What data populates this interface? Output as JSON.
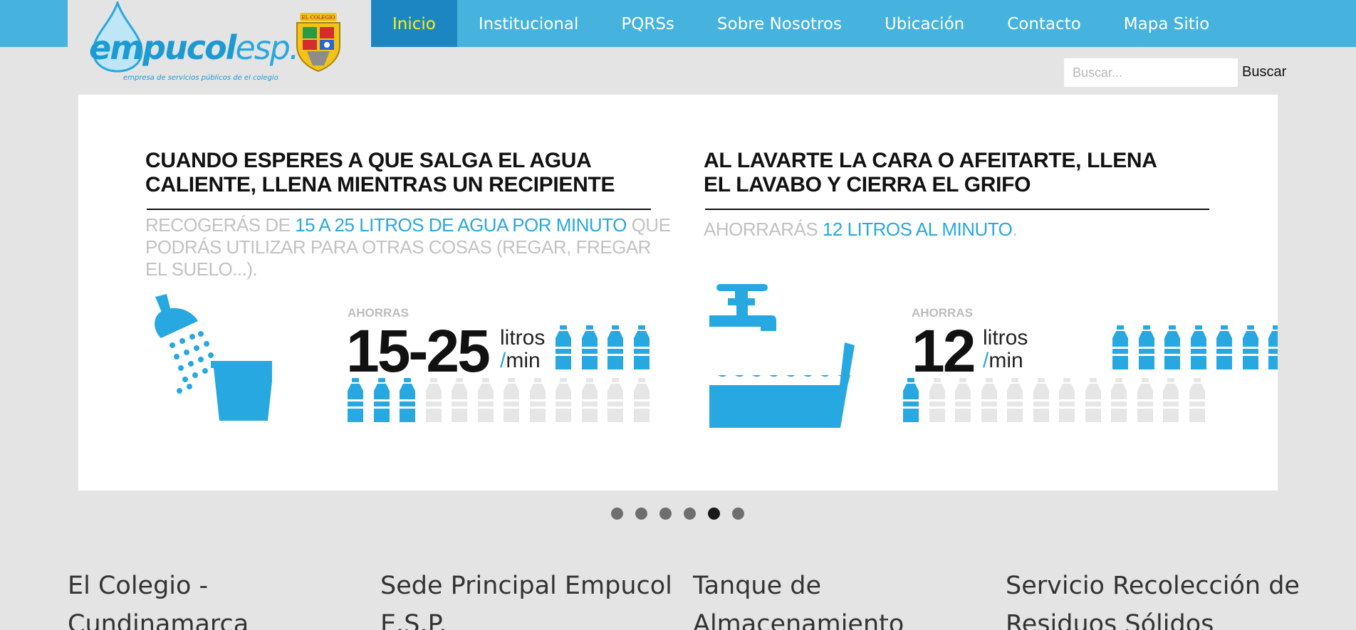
{
  "brand": {
    "logo_text": "empucol",
    "logo_suffix": "esp.",
    "tagline": "empresa de servicios públicos de el colegio",
    "crest_label": "EL COLEGIO"
  },
  "nav": {
    "items": [
      {
        "label": "Inicio",
        "active": true
      },
      {
        "label": "Institucional",
        "active": false
      },
      {
        "label": "PQRSs",
        "active": false
      },
      {
        "label": "Sobre Nosotros",
        "active": false
      },
      {
        "label": "Ubicación",
        "active": false
      },
      {
        "label": "Contacto",
        "active": false
      },
      {
        "label": "Mapa Sitio",
        "active": false
      }
    ]
  },
  "search": {
    "placeholder": "Buscar...",
    "button_label": "Buscar"
  },
  "slide": {
    "left": {
      "headline": "CUANDO ESPERES A QUE SALGA EL AGUA\nCALIENTE, LLENA MIENTRAS UN RECIPIENTE",
      "sub_pre": "RECOGERÁS DE ",
      "sub_highlight": "15 A 25 LITROS DE AGUA POR MINUTO",
      "sub_post": " QUE PODRÁS UTILIZAR PARA OTRAS COSAS (REGAR, FREGAR EL SUELO...).",
      "ahorras": "AHORRAS",
      "amount": "15-25",
      "unit_top": "litros",
      "unit_slash": "/",
      "unit_bottom": "min",
      "bottles_filled": 7,
      "bottles_total": 16
    },
    "right": {
      "headline": "AL LAVARTE LA CARA O AFEITARTE, LLENA\nEL LAVABO Y CIERRA EL GRIFO",
      "sub_pre": "AHORRARÁS ",
      "sub_highlight": "12 LITROS AL MINUTO",
      "sub_post": ".",
      "ahorras": "AHORRAS",
      "amount": "12",
      "unit_top": "litros",
      "unit_slash": "/",
      "unit_bottom": "min",
      "bottles_filled": 8,
      "bottles_total": 19
    }
  },
  "slider": {
    "count": 6,
    "active_index": 4
  },
  "columns": [
    {
      "title": "El Colegio - Cundinamarca"
    },
    {
      "title": "Sede Principal Empucol E.S.P."
    },
    {
      "title": "Tanque de Almacenamiento"
    },
    {
      "title": "Servicio Recolección de Residuos Sólidos"
    }
  ],
  "colors": {
    "nav_bg": "#45b3de",
    "nav_active_bg": "#1c86c3",
    "nav_active_text": "#f7f01a",
    "water_blue": "#28a8e0",
    "bottle_empty": "#e6e6e6"
  }
}
